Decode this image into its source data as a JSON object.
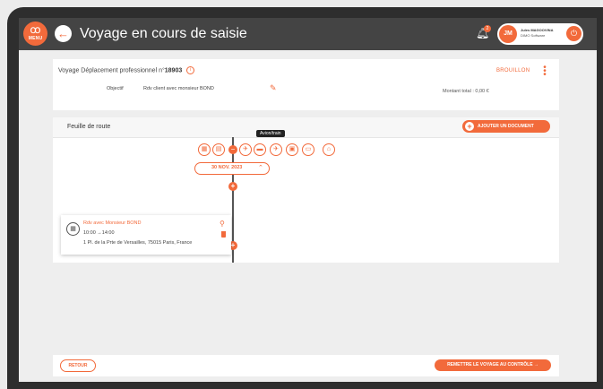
{
  "header": {
    "menu_label": "MENU",
    "title": "Voyage en cours de saisie",
    "notification_count": "2",
    "user": {
      "initials": "JM",
      "name": "Jules MAGOOVINA",
      "company": "DIMO Software"
    }
  },
  "voyage": {
    "title_prefix": "Voyage Déplacement professionnel n°",
    "number": "18903",
    "status": "BROUILLON",
    "objective_label": "Objectif",
    "objective_value": "Rdv client avec monsieur BOND",
    "total": "Montant total : 0,00 €"
  },
  "route": {
    "title": "Feuille de route",
    "add_document": "AJOUTER UN DOCUMENT",
    "tooltip": "Avion/train",
    "date": "30 NOV. 2023",
    "icons": [
      "calendar-icon",
      "note-icon",
      "plane-icon",
      "car-icon",
      "plane-train-icon",
      "bus-icon",
      "taxi-icon",
      "hotel-icon"
    ]
  },
  "event": {
    "title": "Rdv avec Monsieur BOND",
    "time": "10:00 →14:00",
    "address": "1 Pl. de la Prte de Versailles, 75015 Paris, France"
  },
  "footer": {
    "back": "RETOUR",
    "submit": "REMETTRE LE VOYAGE AU CONTRÔLE →"
  },
  "colors": {
    "accent": "#f26a3b",
    "topbar": "#444444",
    "background": "#eeeeee"
  }
}
